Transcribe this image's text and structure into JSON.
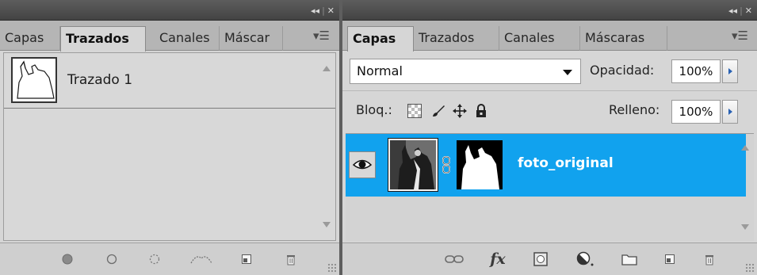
{
  "left_panel": {
    "tabs": [
      {
        "label": "Capas",
        "active": false
      },
      {
        "label": "Trazados",
        "active": true
      },
      {
        "label": "Canales",
        "active": false
      },
      {
        "label": "Máscar",
        "active": false
      }
    ],
    "paths": [
      {
        "name": "Trazado 1"
      }
    ],
    "footer_icons": [
      "fill-path-icon",
      "stroke-path-icon",
      "load-selection-icon",
      "make-work-path-icon",
      "new-path-icon",
      "delete-path-icon"
    ]
  },
  "right_panel": {
    "tabs": [
      {
        "label": "Capas",
        "active": true
      },
      {
        "label": "Trazados",
        "active": false
      },
      {
        "label": "Canales",
        "active": false
      },
      {
        "label": "Máscaras",
        "active": false
      }
    ],
    "blend_mode": "Normal",
    "opacity_label": "Opacidad:",
    "opacity_value": "100%",
    "lock_label": "Bloq.:",
    "fill_label": "Relleno:",
    "fill_value": "100%",
    "layers": [
      {
        "name": "foto_original",
        "selected": true,
        "visible": true
      }
    ],
    "footer_icons": [
      "link-layers-icon",
      "fx-icon",
      "add-mask-icon",
      "adjustment-layer-icon",
      "new-group-icon",
      "new-layer-icon",
      "delete-layer-icon"
    ]
  },
  "colors": {
    "selection": "#11a2ee",
    "panel_bg": "#d6d6d6",
    "titlebar": "#4f4f4f"
  },
  "titlebar": {
    "collapse_glyph": "◂◂",
    "separator": "|",
    "close_glyph": "✕"
  },
  "footer_fx_glyph": "fx"
}
